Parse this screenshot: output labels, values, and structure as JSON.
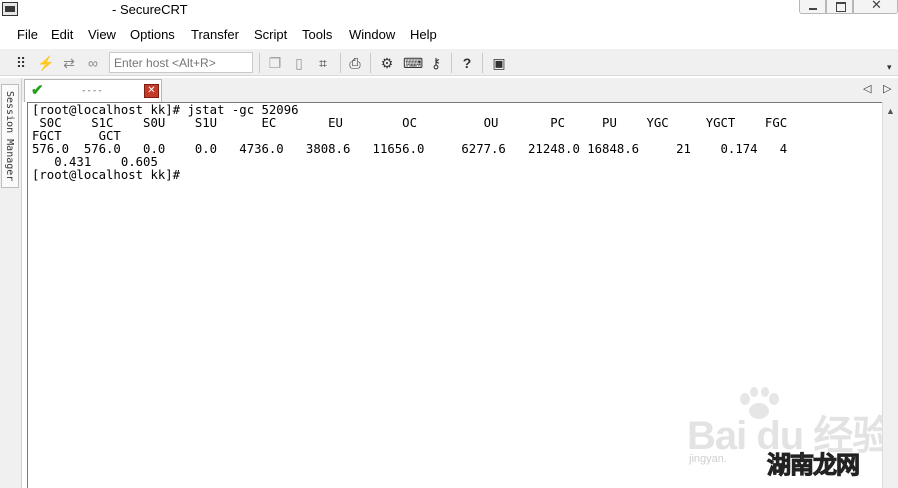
{
  "window": {
    "title": "- SecureCRT"
  },
  "menu": [
    {
      "label": "File"
    },
    {
      "label": "Edit"
    },
    {
      "label": "View"
    },
    {
      "label": "Options"
    },
    {
      "label": "Transfer"
    },
    {
      "label": "Script"
    },
    {
      "label": "Tools"
    },
    {
      "label": "Window"
    },
    {
      "label": "Help"
    }
  ],
  "toolbar": {
    "host_placeholder": "Enter host <Alt+R>",
    "icons": [
      "connect-icon",
      "quick-connect-icon",
      "reconnect-icon",
      "disconnect-icon",
      "copy-icon",
      "paste-icon",
      "find-icon",
      "print-icon",
      "session-options-icon",
      "keymap-icon",
      "key-icon",
      "help-icon",
      "sftp-icon"
    ]
  },
  "session_manager": {
    "label": "Session Manager"
  },
  "tabs": [
    {
      "label": "----",
      "status": "connected"
    }
  ],
  "terminal": {
    "lines": [
      "[root@localhost kk]# jstat -gc 52096",
      " S0C    S1C    S0U    S1U      EC       EU        OC         OU       PC     PU    YGC     YGCT    FGC",
      "FGCT     GCT",
      "576.0  576.0   0.0    0.0   4736.0   3808.6   11656.0     6277.6   21248.0 16848.6     21    0.174   4",
      "   0.431    0.605",
      "[root@localhost kk]# "
    ]
  },
  "watermark": {
    "brand": "Bai du 经验",
    "url": "jingyan.",
    "site": "湖南龙网"
  },
  "colors": {
    "check": "#24a01c",
    "close": "#c53b2a",
    "watermark_orange": "#f09a2e"
  }
}
